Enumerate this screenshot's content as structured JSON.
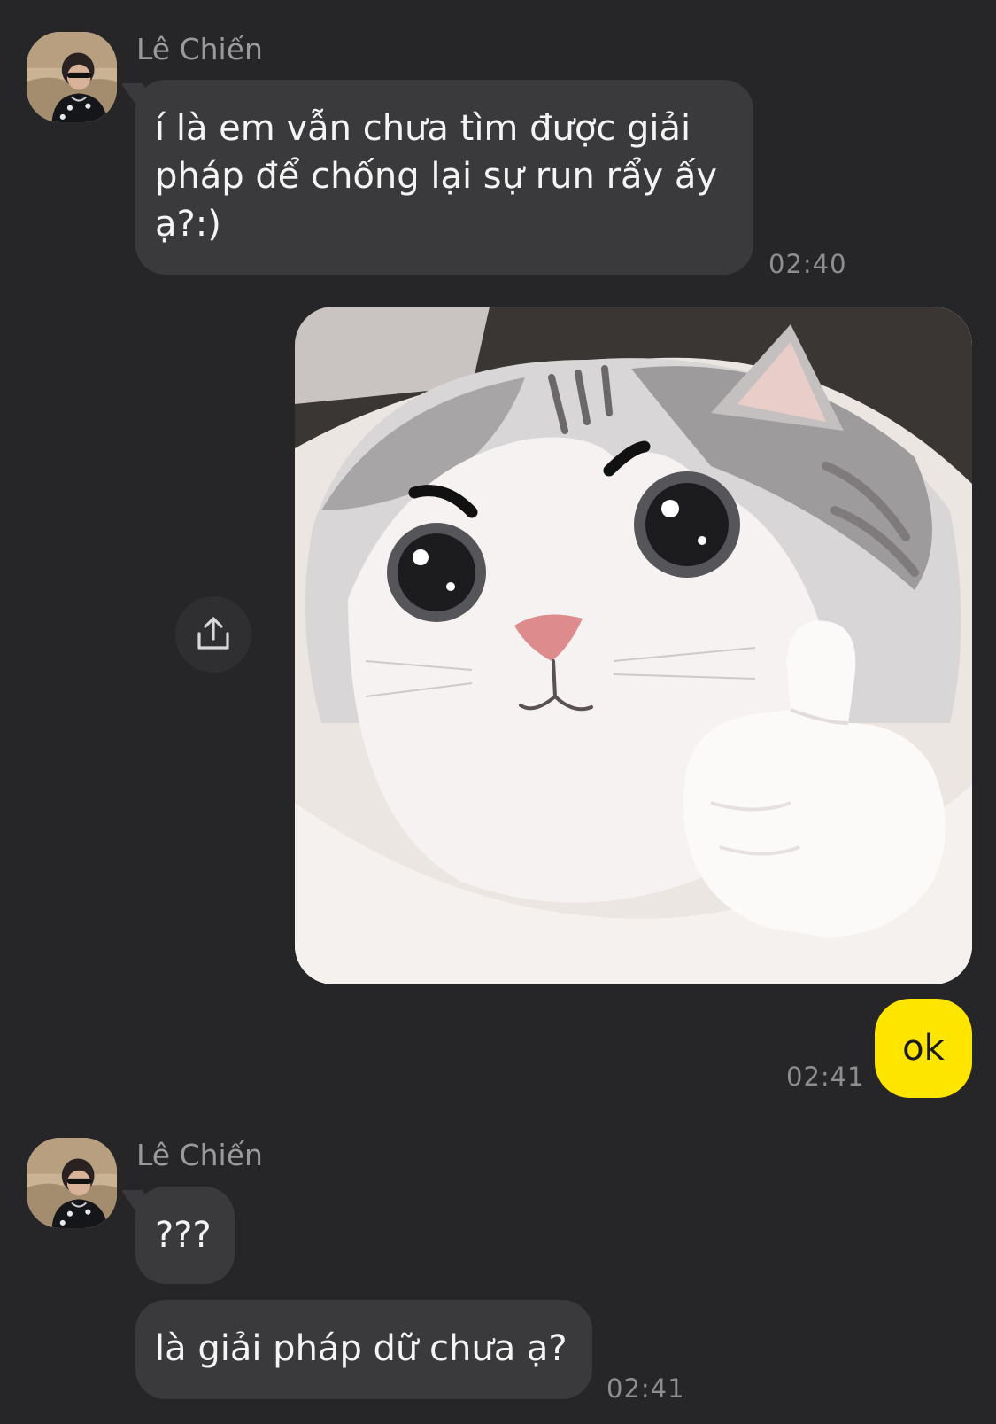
{
  "colors": {
    "background": "#262628",
    "incoming_bubble": "#3a3a3c",
    "outgoing_bubble": "#fee500",
    "timestamp": "#8e8e90",
    "sender_name": "#9a9a9c"
  },
  "messages": {
    "group1": {
      "sender": "Lê Chiến",
      "line1": "í là em vẫn chưa tìm được giải",
      "line2": "pháp để chống lại sự run rẩy ấy",
      "line3": "ạ?:)",
      "time": "02:40"
    },
    "outgoing": {
      "image_icon": "cat-thumbs-up-sticker",
      "share_icon": "share-icon",
      "text": "ok",
      "time": "02:41"
    },
    "group2": {
      "sender": "Lê Chiến",
      "msg1": "???",
      "msg2": "là giải pháp dữ chưa ạ?",
      "time": "02:41"
    }
  }
}
